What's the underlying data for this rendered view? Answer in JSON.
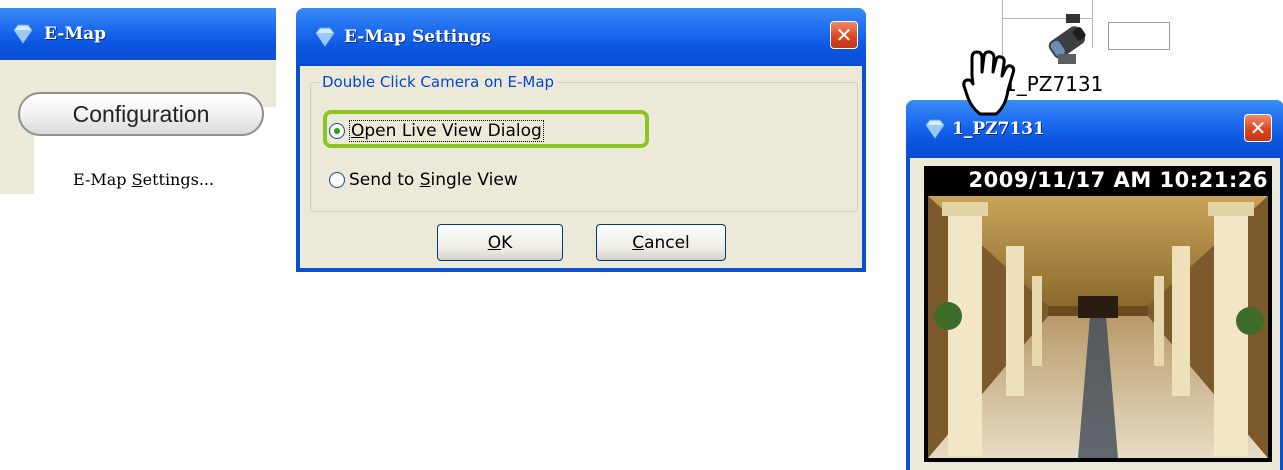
{
  "emap_panel": {
    "title": "E-Map",
    "icon": "diamond-icon",
    "config_button_label": "Configuration",
    "menu_item_prefix": "E-Map ",
    "menu_item_mnemonic": "S",
    "menu_item_suffix": "ettings..."
  },
  "settings_dialog": {
    "title": "E-Map Settings",
    "close_icon": "close-icon",
    "group_label": "Double Click Camera on E-Map",
    "options": [
      {
        "mnemonic": "O",
        "rest": "pen Live View Dialog",
        "checked": true
      },
      {
        "prefix": "Send to ",
        "mnemonic": "S",
        "rest": "ingle View",
        "checked": false
      }
    ],
    "ok_mnemonic": "O",
    "ok_rest": "K",
    "cancel_mnemonic": "C",
    "cancel_rest": "ancel",
    "highlight_color": "#8cc423"
  },
  "map": {
    "camera_label": "1_PZ7131",
    "camera_icon": "ptz-camera-icon",
    "cursor_icon": "hand-cursor-icon"
  },
  "live_view": {
    "title": "1_PZ7131",
    "timestamp": "2009/11/17 AM 10:21:26",
    "image": "hotel-lobby-video-frame"
  },
  "colors": {
    "xp_blue": "#0a4ed2",
    "dialog_face": "#ece9d8",
    "close_red": "#d8441d"
  }
}
